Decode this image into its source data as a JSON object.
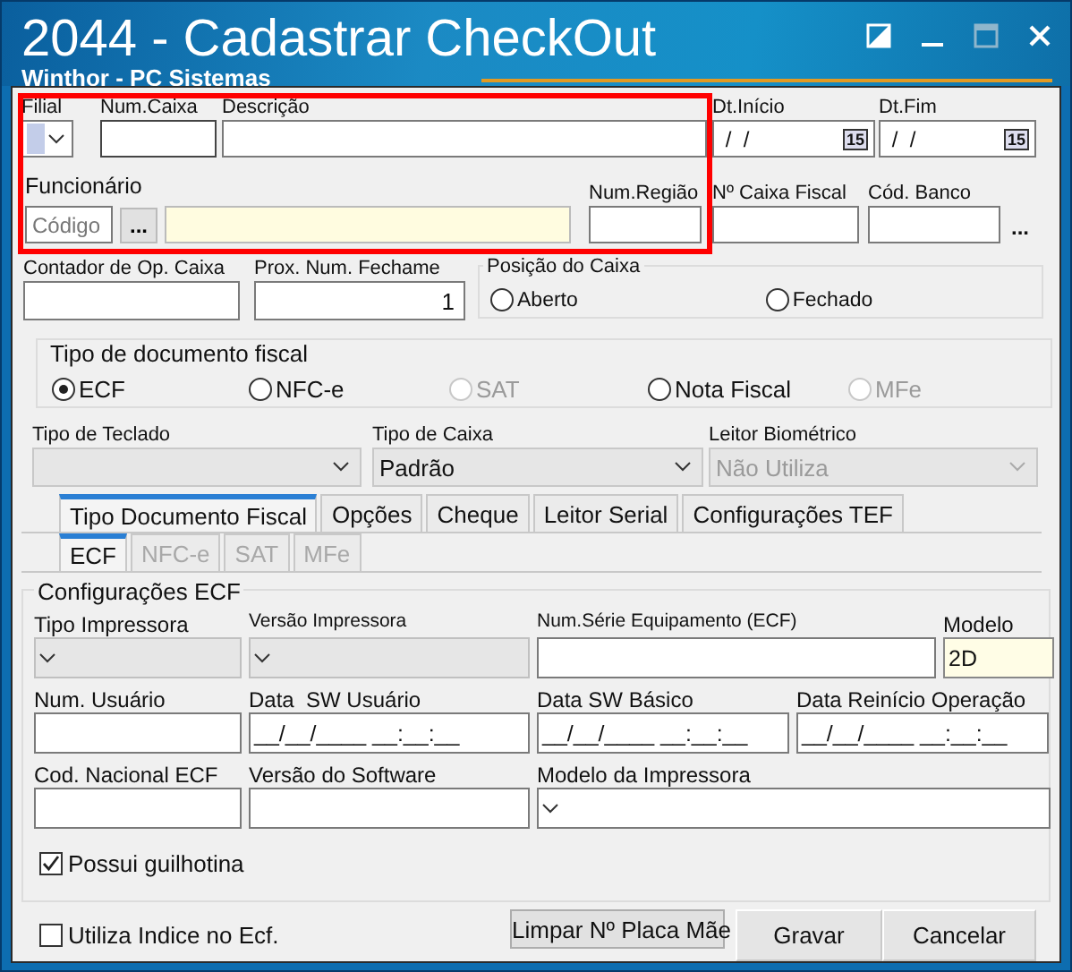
{
  "window": {
    "title": "2044 - Cadastrar CheckOut",
    "subtitle": "Winthor - PC Sistemas"
  },
  "top_fields": [
    {
      "label": "Filial",
      "kind": "combo"
    },
    {
      "label": "Num.Caixa",
      "kind": "text"
    },
    {
      "label": "Descrição",
      "kind": "text"
    },
    {
      "label": "Dt.Início",
      "kind": "date",
      "value": " /  /",
      "calendar": "15"
    },
    {
      "label": "Dt.Fim",
      "kind": "date",
      "value": " /  /",
      "calendar": "15"
    }
  ],
  "funcionario": {
    "label": "Funcionário",
    "placeholder": "Código",
    "lookup_button": "..."
  },
  "mid_fields": [
    {
      "label": "Num.Região"
    },
    {
      "label": "Nº Caixa Fiscal"
    },
    {
      "label": "Cód. Banco",
      "lookup_button": "..."
    }
  ],
  "contador": {
    "label": "Contador de Op. Caixa"
  },
  "prox_num": {
    "label": "Prox. Num. Fechame",
    "value": "1"
  },
  "posicao": {
    "label": "Posição do Caixa",
    "options": [
      {
        "label": "Aberto",
        "selected": false
      },
      {
        "label": "Fechado",
        "selected": false
      }
    ]
  },
  "tipo_documento": {
    "label": "Tipo de documento fiscal",
    "options": [
      {
        "label": "ECF",
        "selected": true,
        "disabled": false
      },
      {
        "label": "NFC-e",
        "selected": false,
        "disabled": false
      },
      {
        "label": "SAT",
        "selected": false,
        "disabled": true
      },
      {
        "label": "Nota Fiscal",
        "selected": false,
        "disabled": false
      },
      {
        "label": "MFe",
        "selected": false,
        "disabled": true
      }
    ]
  },
  "selects": [
    {
      "label": "Tipo de Teclado",
      "disabled": false
    },
    {
      "label": "Tipo de Caixa",
      "value": "Padrão",
      "disabled": false
    },
    {
      "label": "Leitor Biométrico",
      "value": "Não Utiliza",
      "disabled": true
    }
  ],
  "tabs": [
    {
      "label": "Tipo Documento Fiscal",
      "selected": true
    },
    {
      "label": "Opções",
      "selected": false
    },
    {
      "label": "Cheque",
      "selected": false
    },
    {
      "label": "Leitor Serial",
      "selected": false
    },
    {
      "label": "Configurações TEF",
      "selected": false
    }
  ],
  "subtabs": [
    {
      "label": "ECF",
      "selected": true,
      "disabled": false
    },
    {
      "label": "NFC-e",
      "selected": false,
      "disabled": true
    },
    {
      "label": "SAT",
      "selected": false,
      "disabled": true
    },
    {
      "label": "MFe",
      "selected": false,
      "disabled": true
    }
  ],
  "ecf": {
    "title": "Configurações ECF",
    "rows": [
      [
        {
          "label": "Tipo Impressora",
          "kind": "combo"
        },
        {
          "label": "Versão Impressora",
          "kind": "combo"
        },
        {
          "label": "Num.Série Equipamento (ECF)",
          "kind": "text"
        },
        {
          "label": "Modelo",
          "kind": "highlighted",
          "value": "2D"
        }
      ],
      [
        {
          "label": "Num. Usuário",
          "kind": "text"
        },
        {
          "label": "Data  SW Usuário",
          "kind": "text",
          "value": "__/__/____ __:__:__"
        },
        {
          "label": "Data SW Básico",
          "kind": "text",
          "value": "__/__/____ __:__:__"
        },
        {
          "label": "Data Reinício Operação",
          "kind": "text",
          "value": "__/__/____ __:__:__"
        }
      ],
      [
        {
          "label": "Cod. Nacional ECF",
          "kind": "text"
        },
        {
          "label": "Versão do Software",
          "kind": "text"
        },
        {
          "label": "Modelo da Impressora",
          "kind": "combo"
        }
      ]
    ],
    "guilhotina": {
      "label": "Possui guilhotina",
      "checked": true
    }
  },
  "utiliza_indice": {
    "label": "Utiliza Indice no Ecf.",
    "checked": false
  },
  "buttons": [
    {
      "label": "Limpar Nº Placa Mãe",
      "kind": "flat"
    },
    {
      "label": "Gravar",
      "kind": "raised"
    },
    {
      "label": "Cancelar",
      "kind": "raised"
    }
  ]
}
